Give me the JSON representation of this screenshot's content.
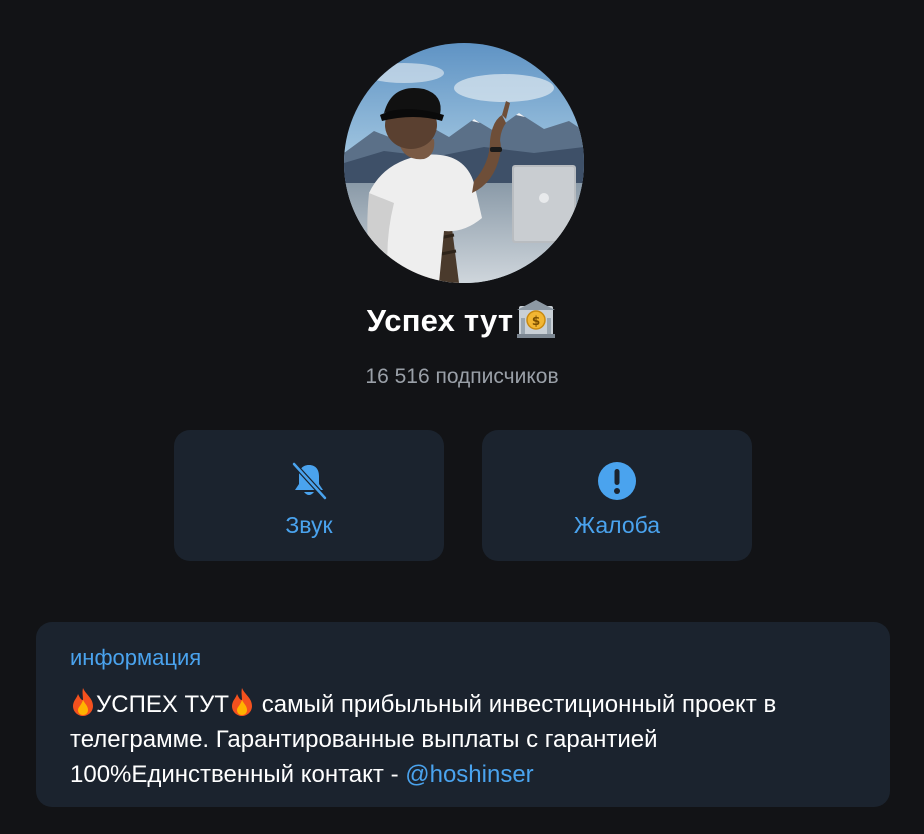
{
  "channel": {
    "title": "Успех тут",
    "title_emoji": "bank-emoji-icon",
    "subscribers": "16 516 подписчиков"
  },
  "actions": {
    "sound_label": "Звук",
    "sound_icon": "bell-muted-icon",
    "report_label": "Жалоба",
    "report_icon": "exclamation-circle-icon"
  },
  "info": {
    "heading": "информация",
    "text_emoji_1": "fire-emoji-icon",
    "text_part1": "УСПЕХ ТУТ",
    "text_emoji_2": "fire-emoji-icon",
    "text_part2": " самый прибыльный инвестиционный проект в телеграмме. Гарантированные выплаты с гарантией 100%Единственный контакт - ",
    "contact_link": "@hoshinser"
  },
  "colors": {
    "background": "#121316",
    "card": "#1b232e",
    "accent": "#4aa3ee",
    "secondary_text": "#9aa0a8",
    "primary_text": "#ffffff"
  }
}
